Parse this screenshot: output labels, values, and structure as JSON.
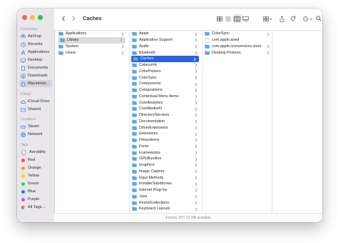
{
  "window": {
    "title": "Caches"
  },
  "sidebar": {
    "favourites": {
      "header": "Favourites",
      "items": [
        {
          "label": "AirDrop",
          "icon": "airdrop-icon"
        },
        {
          "label": "Recents",
          "icon": "clock-icon"
        },
        {
          "label": "Applications",
          "icon": "applications-icon"
        },
        {
          "label": "Desktop",
          "icon": "desktop-icon"
        },
        {
          "label": "Documents",
          "icon": "document-icon"
        },
        {
          "label": "Downloads",
          "icon": "download-icon"
        },
        {
          "label": "Macintosh…",
          "icon": "house-icon"
        }
      ]
    },
    "icloud": {
      "header": "iCloud",
      "items": [
        {
          "label": "iCloud Drive",
          "icon": "cloud-icon"
        },
        {
          "label": "Shared",
          "icon": "shared-folder-icon"
        }
      ]
    },
    "locations": {
      "header": "Locations",
      "items": [
        {
          "label": "Steam",
          "icon": "drive-icon"
        },
        {
          "label": "Network",
          "icon": "globe-icon"
        }
      ]
    },
    "tags": {
      "header": "Tags",
      "items": [
        {
          "label": "Aerobility",
          "color": "#ffffff"
        },
        {
          "label": "Red",
          "color": "#ff4f47"
        },
        {
          "label": "Orange",
          "color": "#ff9f0a"
        },
        {
          "label": "Yellow",
          "color": "#ffd60a"
        },
        {
          "label": "Green",
          "color": "#30d158"
        },
        {
          "label": "Blue",
          "color": "#0a84ff"
        },
        {
          "label": "Purple",
          "color": "#bf5af2"
        },
        {
          "label": "All Tags…",
          "color": "#c8c8c8"
        }
      ]
    }
  },
  "columns": {
    "c1": [
      {
        "label": "Applications"
      },
      {
        "label": "Library",
        "state": "selected"
      },
      {
        "label": "System"
      },
      {
        "label": "Users"
      }
    ],
    "c2": [
      {
        "label": "Apple"
      },
      {
        "label": "Application Support"
      },
      {
        "label": "Audio"
      },
      {
        "label": "Bluetooth"
      },
      {
        "label": "Caches",
        "state": "active"
      },
      {
        "label": "Catacomb"
      },
      {
        "label": "ColorPickers"
      },
      {
        "label": "ColorSync"
      },
      {
        "label": "Components"
      },
      {
        "label": "Compositions"
      },
      {
        "label": "Contextual Menu Items"
      },
      {
        "label": "CoreAnalytics"
      },
      {
        "label": "CoreMediaIO"
      },
      {
        "label": "DirectoryServices"
      },
      {
        "label": "Documentation"
      },
      {
        "label": "DriverExtensions"
      },
      {
        "label": "Extensions"
      },
      {
        "label": "Filesystems"
      },
      {
        "label": "Fonts"
      },
      {
        "label": "Frameworks"
      },
      {
        "label": "GPUBundles"
      },
      {
        "label": "Graphics"
      },
      {
        "label": "Image Capture"
      },
      {
        "label": "Input Methods"
      },
      {
        "label": "InstallerSandboxes"
      },
      {
        "label": "Internet Plug-Ins"
      },
      {
        "label": "Java"
      },
      {
        "label": "KernelCollections"
      },
      {
        "label": "Keyboard Layouts"
      }
    ],
    "c3": [
      {
        "label": "ColorSync",
        "type": "folder"
      },
      {
        "label": "com.apple.aned",
        "type": "file"
      },
      {
        "label": "com.apple.iconservices.store",
        "type": "folder"
      },
      {
        "label": "Desktop Pictures",
        "type": "folder"
      }
    ]
  },
  "status": {
    "text": "4 items, 877.72 GB available"
  },
  "colors": {
    "accent": "#2863e6",
    "folder": "#5aa9ea"
  }
}
